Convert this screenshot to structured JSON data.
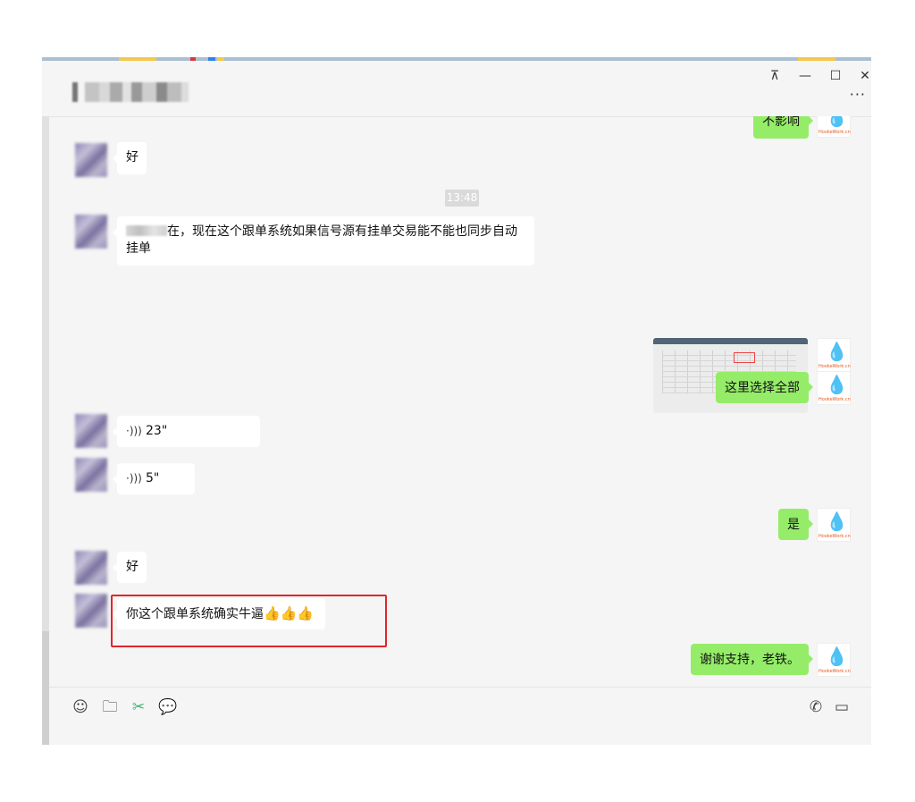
{
  "window": {
    "chat_title": "D",
    "controls": {
      "pin": "⊼",
      "minimize": "—",
      "maximize": "☐",
      "close": "✕",
      "more": "···"
    }
  },
  "messages": {
    "top_partial_right": "不影响",
    "m1_left": "好",
    "timestamp": "13:48",
    "m2_left_text": "在，现在这个跟单系统如果信号源有挂单交易能不能也同步自动挂单",
    "m3_right": "这里选择全部",
    "voice1_duration": "23\"",
    "voice2_duration": "5\"",
    "m4_right": "是",
    "m5_left": "好",
    "m6_left": "你这个跟单系统确实牛逼",
    "m6_emojis": "👍👍👍",
    "m7_right": "谢谢支持，老铁。"
  },
  "avatar_brand": "HookeWork.cn",
  "colors": {
    "bubble_right": "#95ec69",
    "highlight_border": "#e0262b",
    "brand": "#e85a1b"
  },
  "toolbar": {
    "emoji_icon": "☺",
    "folder_icon": "🗀",
    "scissors_icon": "✂",
    "chat_icon": "💬",
    "phone_icon": "✆",
    "video_icon": "▭"
  }
}
